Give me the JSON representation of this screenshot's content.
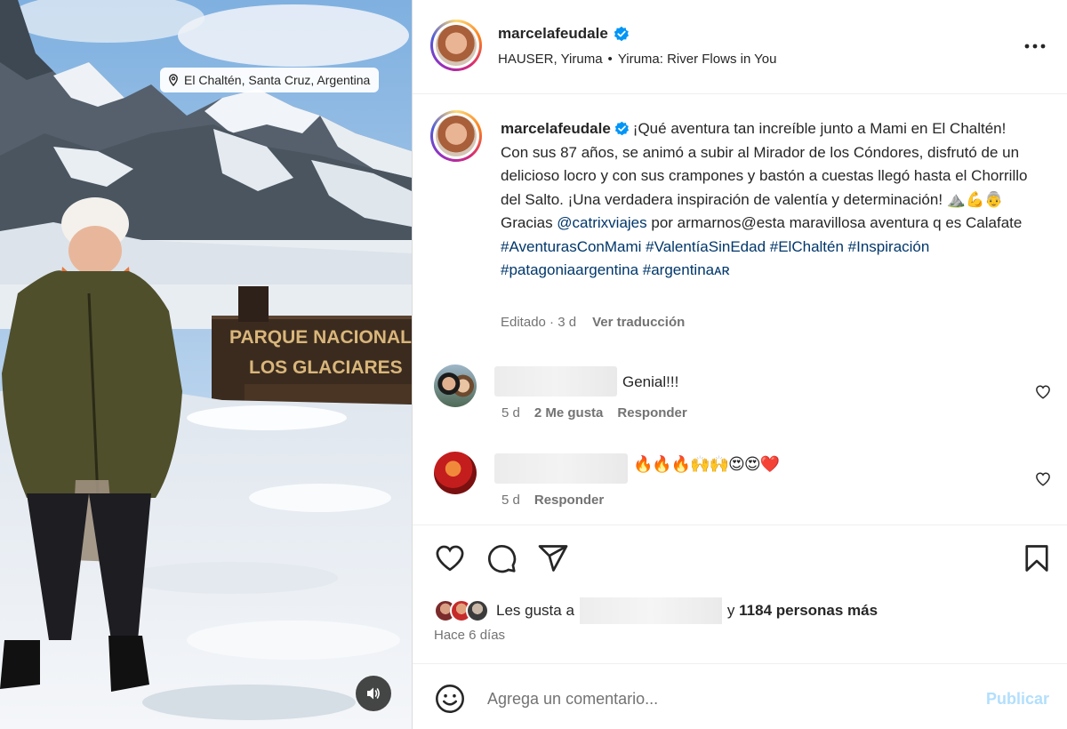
{
  "media": {
    "location": "El Chaltén, Santa Cruz, Argentina",
    "sign_line1": "PARQUE NACIONAL",
    "sign_line2": "LOS GLACIARES",
    "audio_icon": "speaker-icon"
  },
  "header": {
    "username": "marcelafeudale",
    "verified": true,
    "music_artists": "HAUSER, Yiruma",
    "music_separator": "•",
    "music_track": "Yiruma: River Flows in You",
    "more_icon": "more-horizontal-icon"
  },
  "caption": {
    "username": "marcelafeudale",
    "text_1": "¡Qué aventura tan increíble junto a Mami en El Chaltén! Con sus 87 años, se animó a subir al Mirador de los Cóndores, disfrutó de un delicioso locro y con sus crampones y bastón a cuestas llegó hasta el Chorrillo del Salto. ¡Una verdadera inspiración de valentía y determinación! ",
    "emojis": "⛰️💪👵",
    "text_2": " Gracias ",
    "mention": "@catrixviajes",
    "text_3": " por armarnos@esta maravillosa aventura q es Calafate ",
    "hashtags": [
      "#AventurasConMami",
      "#ValentíaSinEdad",
      "#ElChaltén",
      "#Inspiración",
      "#patagoniaargentina",
      "#argentinaᴀʀ"
    ],
    "edited": "Editado · 3 d",
    "translate": "Ver traducción"
  },
  "comments": [
    {
      "text": "Genial!!!",
      "time": "5 d",
      "likes": "2 Me gusta",
      "reply": "Responder"
    },
    {
      "text": "🔥🔥🔥🙌🙌😍😍❤️",
      "time": "5 d",
      "reply": "Responder"
    }
  ],
  "actions": {
    "like_icon": "heart-icon",
    "comment_icon": "comment-icon",
    "share_icon": "share-icon",
    "save_icon": "bookmark-icon"
  },
  "likes": {
    "prefix": "Les gusta a",
    "suffix": "y",
    "count": "1184 personas más",
    "time_ago": "Hace 6 días"
  },
  "add_comment": {
    "placeholder": "Agrega un comentario...",
    "publish": "Publicar",
    "emoji_icon": "smiley-icon"
  },
  "colors": {
    "link": "#00376b",
    "secondary_text": "#737373",
    "verified_blue": "#0095f6",
    "publish_disabled": "#b2dffc"
  }
}
